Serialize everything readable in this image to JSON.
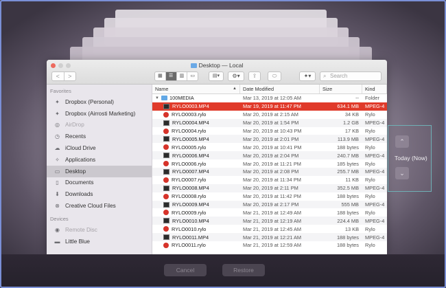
{
  "window": {
    "title": "Desktop — Local"
  },
  "toolbar": {
    "back": "<",
    "forward": ">",
    "search_placeholder": "Search"
  },
  "sidebar": {
    "favorites_label": "Favorites",
    "favorites": [
      {
        "label": "Dropbox (Personal)",
        "icon": "dropbox-icon"
      },
      {
        "label": "Dropbox (Airrosti Marketing)",
        "icon": "dropbox-icon"
      },
      {
        "label": "AirDrop",
        "icon": "airdrop-icon",
        "disabled": true
      },
      {
        "label": "Recents",
        "icon": "clock-icon"
      },
      {
        "label": "iCloud Drive",
        "icon": "cloud-icon"
      },
      {
        "label": "Applications",
        "icon": "applications-icon"
      },
      {
        "label": "Desktop",
        "icon": "desktop-icon",
        "active": true
      },
      {
        "label": "Documents",
        "icon": "document-icon"
      },
      {
        "label": "Downloads",
        "icon": "download-icon"
      },
      {
        "label": "Creative Cloud Files",
        "icon": "creative-cloud-icon"
      }
    ],
    "devices_label": "Devices",
    "devices": [
      {
        "label": "Remote Disc",
        "icon": "disc-icon",
        "disabled": true
      },
      {
        "label": "Little Blue",
        "icon": "drive-icon"
      }
    ]
  },
  "columns": {
    "name": "Name",
    "date": "Date Modified",
    "size": "Size",
    "kind": "Kind"
  },
  "files": {
    "folder": {
      "name": "100MEDIA",
      "date": "Mar 13, 2019 at 12:05 AM",
      "size": "--",
      "kind": "Folder"
    },
    "rows": [
      {
        "name": "RYLO0003.MP4",
        "date": "Mar 19, 2019 at 11:47 PM",
        "size": "634.1 MB",
        "kind": "MPEG-4",
        "type": "mp4",
        "selected": true
      },
      {
        "name": "RYLO0003.rylo",
        "date": "Mar 20, 2019 at 2:15 AM",
        "size": "34 KB",
        "kind": "Rylo",
        "type": "rylo"
      },
      {
        "name": "RYLO0004.MP4",
        "date": "Mar 20, 2019 at 1:54 PM",
        "size": "1.2 GB",
        "kind": "MPEG-4",
        "type": "mp4"
      },
      {
        "name": "RYLO0004.rylo",
        "date": "Mar 20, 2019 at 10:43 PM",
        "size": "17 KB",
        "kind": "Rylo",
        "type": "rylo"
      },
      {
        "name": "RYLO0005.MP4",
        "date": "Mar 20, 2019 at 2:01 PM",
        "size": "113.9 MB",
        "kind": "MPEG-4",
        "type": "mp4"
      },
      {
        "name": "RYLO0005.rylo",
        "date": "Mar 20, 2019 at 10:41 PM",
        "size": "188 bytes",
        "kind": "Rylo",
        "type": "rylo"
      },
      {
        "name": "RYLO0006.MP4",
        "date": "Mar 20, 2019 at 2:04 PM",
        "size": "240.7 MB",
        "kind": "MPEG-4",
        "type": "mp4"
      },
      {
        "name": "RYLO0006.rylo",
        "date": "Mar 20, 2019 at 11:21 PM",
        "size": "185 bytes",
        "kind": "Rylo",
        "type": "rylo"
      },
      {
        "name": "RYLO0007.MP4",
        "date": "Mar 20, 2019 at 2:08 PM",
        "size": "255.7 MB",
        "kind": "MPEG-4",
        "type": "mp4"
      },
      {
        "name": "RYLO0007.rylo",
        "date": "Mar 20, 2019 at 11:34 PM",
        "size": "11 KB",
        "kind": "Rylo",
        "type": "rylo"
      },
      {
        "name": "RYLO0008.MP4",
        "date": "Mar 20, 2019 at 2:11 PM",
        "size": "352.5 MB",
        "kind": "MPEG-4",
        "type": "mp4"
      },
      {
        "name": "RYLO0008.rylo",
        "date": "Mar 20, 2019 at 11:42 PM",
        "size": "188 bytes",
        "kind": "Rylo",
        "type": "rylo"
      },
      {
        "name": "RYLO0009.MP4",
        "date": "Mar 20, 2019 at 2:17 PM",
        "size": "555 MB",
        "kind": "MPEG-4",
        "type": "mp4"
      },
      {
        "name": "RYLO0009.rylo",
        "date": "Mar 21, 2019 at 12:49 AM",
        "size": "188 bytes",
        "kind": "Rylo",
        "type": "rylo"
      },
      {
        "name": "RYLO0010.MP4",
        "date": "Mar 21, 2019 at 12:19 AM",
        "size": "224.4 MB",
        "kind": "MPEG-4",
        "type": "mp4"
      },
      {
        "name": "RYLO0010.rylo",
        "date": "Mar 21, 2019 at 12:45 AM",
        "size": "13 KB",
        "kind": "Rylo",
        "type": "rylo"
      },
      {
        "name": "RYLO0011.MP4",
        "date": "Mar 21, 2019 at 12:21 AM",
        "size": "188 bytes",
        "kind": "MPEG-4",
        "type": "mp4"
      },
      {
        "name": "RYLO0011.rylo",
        "date": "Mar 21, 2019 at 12:59 AM",
        "size": "188 bytes",
        "kind": "Rylo",
        "type": "rylo"
      }
    ]
  },
  "timeline": {
    "label": "Today (Now)"
  },
  "buttons": {
    "cancel": "Cancel",
    "restore": "Restore"
  }
}
